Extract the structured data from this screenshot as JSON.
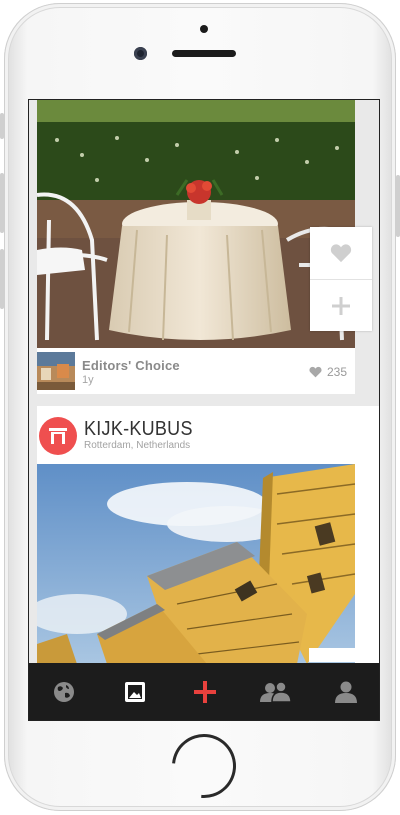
{
  "feed": {
    "post1": {
      "collection_title": "Editors' Choice",
      "age": "1y",
      "like_count": "235"
    },
    "post2": {
      "place_name": "KIJK-KUBUS",
      "location": "Rotterdam, Netherlands"
    }
  },
  "icons": {
    "like": "heart-icon",
    "add": "plus-icon",
    "likes_count": "heart-icon",
    "place_logo": "arch-logo-icon"
  },
  "tabbar": {
    "items": [
      {
        "icon": "globe-icon",
        "active": false
      },
      {
        "icon": "photo-icon",
        "active": true
      },
      {
        "icon": "plus-icon",
        "active": false,
        "accent": "#e8413d"
      },
      {
        "icon": "friends-icon",
        "active": false
      },
      {
        "icon": "profile-icon",
        "active": false
      }
    ]
  },
  "colors": {
    "accent": "#e8413d",
    "logo_bg": "#ef4f4f",
    "tabbar_bg": "#1c1c1c"
  }
}
